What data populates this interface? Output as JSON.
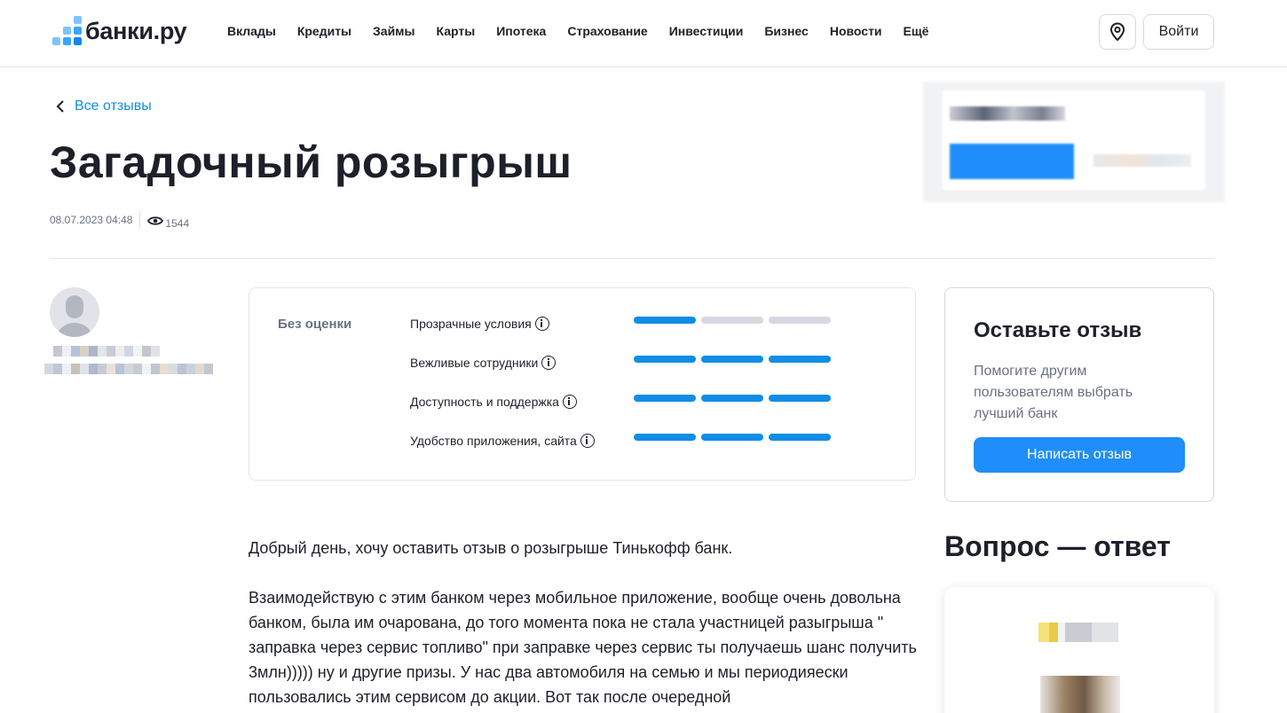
{
  "brand": {
    "name": "банки.ру",
    "accent": "#0f8ee6",
    "button": "#1f8efa"
  },
  "nav": {
    "items": [
      "Вклады",
      "Кредиты",
      "Займы",
      "Карты",
      "Ипотека",
      "Страхование",
      "Инвестиции",
      "Бизнес",
      "Новости",
      "Ещё"
    ],
    "location_icon": "location-pin-icon",
    "login_label": "Войти"
  },
  "page": {
    "back_label": "Все отзывы",
    "title": "Загадочный розыгрыш",
    "date": "08.07.2023 04:48",
    "views": "1544"
  },
  "ratings": {
    "overall": "Без оценки",
    "criteria": [
      {
        "label": "Прозрачные условия",
        "score": 1,
        "max": 3
      },
      {
        "label": "Вежливые сотрудники",
        "score": 3,
        "max": 3
      },
      {
        "label": "Доступность и поддержка",
        "score": 3,
        "max": 3
      },
      {
        "label": "Удобство приложения, сайта",
        "score": 3,
        "max": 3
      }
    ]
  },
  "review": {
    "paragraphs": [
      "Добрый день, хочу оставить отзыв о розыгрыше Тинькофф банк.",
      "Взаимодействую с этим банком через мобильное приложение, вообще очень довольна банком, была им очарована, до того момента пока не стала участницей разыгрыша \" заправка через сервис топливо\" при заправке через сервис ты получаешь шанс получить 3млн))))) ну и другие призы. У нас два автомобиля на семью и мы периодияески пользовались этим сервисом до акции. Вот так после очередной"
    ]
  },
  "cta": {
    "title": "Оставьте отзыв",
    "text": "Помогите другим пользователям выбрать лучший банк",
    "button": "Написать отзыв"
  },
  "qa": {
    "title": "Вопрос — ответ"
  }
}
